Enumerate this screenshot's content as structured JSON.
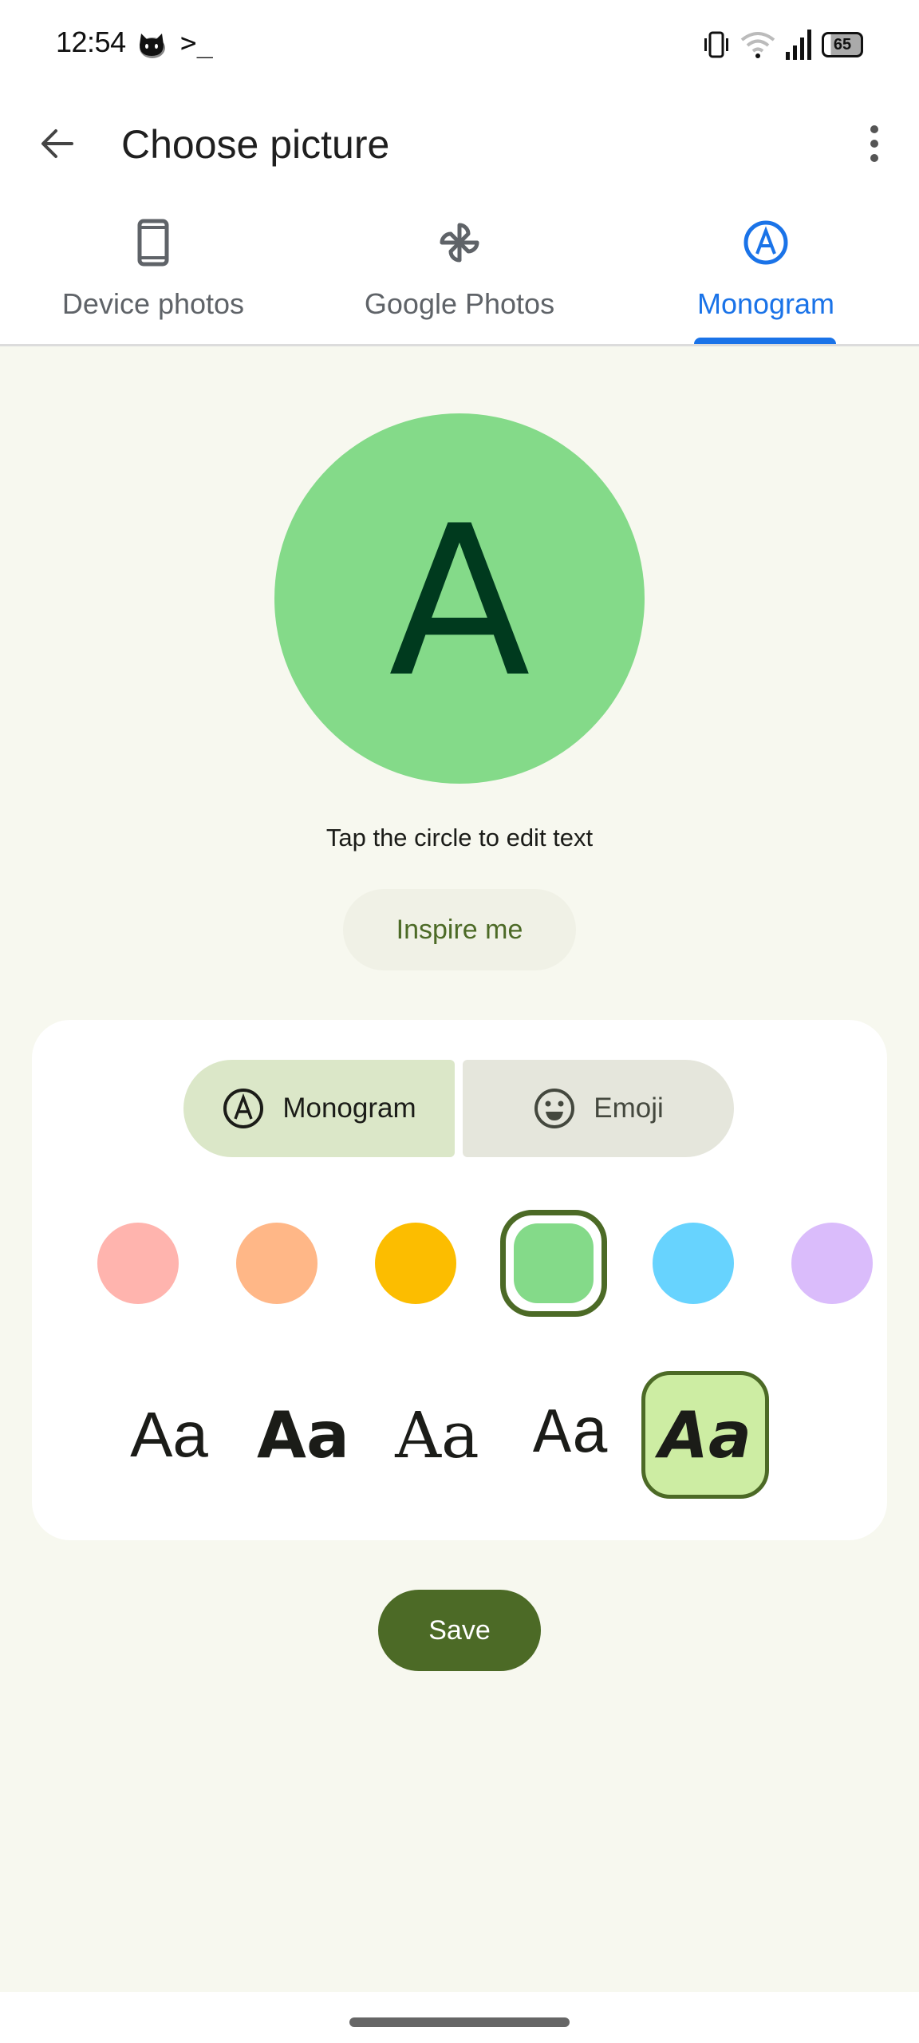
{
  "status_bar": {
    "time": "12:54",
    "terminal_glyph": ">_",
    "battery_level": "65",
    "icons": [
      "cat-notification-icon",
      "terminal-icon",
      "vibrate-icon",
      "wifi-icon",
      "signal-icon",
      "battery-icon"
    ]
  },
  "app_bar": {
    "title": "Choose picture",
    "back_icon": "arrow-back-icon",
    "more_icon": "more-vert-icon"
  },
  "tabs": [
    {
      "label": "Device photos",
      "icon": "phone-icon",
      "active": false
    },
    {
      "label": "Google Photos",
      "icon": "pinwheel-icon",
      "active": false
    },
    {
      "label": "Monogram",
      "icon": "circled-a-icon",
      "active": true
    }
  ],
  "monogram": {
    "letter": "A",
    "background_color": "#84da89",
    "letter_color": "#003a1e"
  },
  "hint_text": "Tap the circle to edit text",
  "inspire_label": "Inspire me",
  "segmented": [
    {
      "label": "Monogram",
      "icon": "circled-a-icon",
      "selected": true
    },
    {
      "label": "Emoji",
      "icon": "smiley-icon",
      "selected": false
    }
  ],
  "colors": [
    {
      "name": "pink",
      "hex": "#ffb4ae",
      "selected": false
    },
    {
      "name": "orange",
      "hex": "#ffb787",
      "selected": false
    },
    {
      "name": "yellow",
      "hex": "#fcbd00",
      "selected": false
    },
    {
      "name": "green",
      "hex": "#84da89",
      "selected": true
    },
    {
      "name": "blue",
      "hex": "#67d3fe",
      "selected": false
    },
    {
      "name": "purple",
      "hex": "#dabcfb",
      "selected": false
    }
  ],
  "font_options": [
    {
      "label": "Aa",
      "style": "sans",
      "selected": false
    },
    {
      "label": "Aa",
      "style": "sans-bold",
      "selected": false
    },
    {
      "label": "Aa",
      "style": "serif",
      "selected": false
    },
    {
      "label": "Aa",
      "style": "mono",
      "selected": false
    },
    {
      "label": "Aa",
      "style": "handwritten",
      "selected": true
    }
  ],
  "save_label": "Save",
  "accent_colors": {
    "primary": "#4c6a26",
    "tab_active": "#1a73e8"
  }
}
